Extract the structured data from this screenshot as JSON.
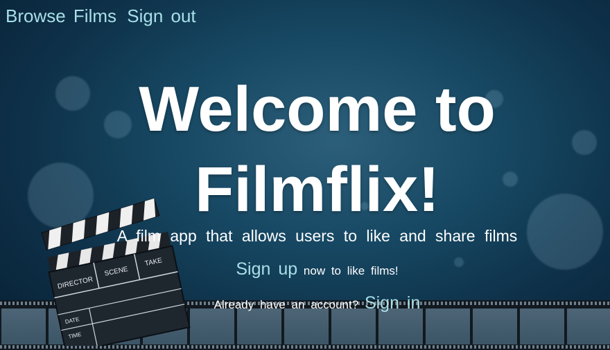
{
  "nav": {
    "browse_films": "Browse Films",
    "sign_out": "Sign out"
  },
  "hero": {
    "title_line1": "Welcome to",
    "title_line2": "Filmflix!"
  },
  "tagline": "A film app that allows users to like and share films",
  "signup": {
    "link": "Sign up",
    "suffix": "now to like films!"
  },
  "signin": {
    "prefix": "Already have an account?",
    "link": "Sign in"
  },
  "clapperboard": {
    "director": "DIRECTOR",
    "scene": "SCENE",
    "take": "TAKE",
    "date": "DATE",
    "time": "TIME"
  },
  "colors": {
    "link": "#a9dfe8",
    "background": "#174863",
    "text": "#ffffff"
  }
}
